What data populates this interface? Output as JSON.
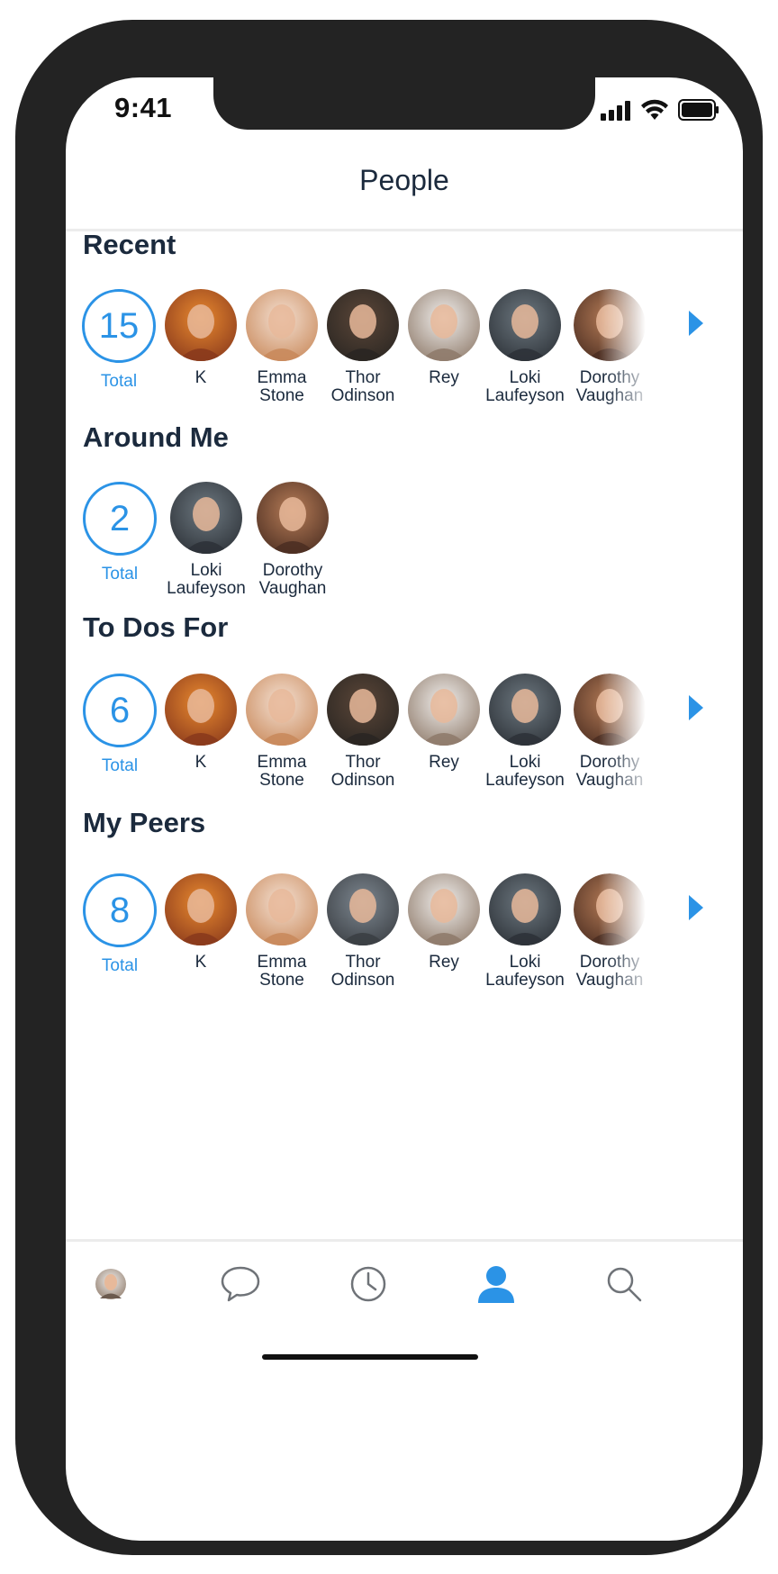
{
  "status_bar": {
    "time": "9:41"
  },
  "header": {
    "title": "People"
  },
  "sections": [
    {
      "title": "Recent",
      "total": "15",
      "total_label": "Total",
      "people": [
        {
          "name": "K",
          "avatar": "orange"
        },
        {
          "name": "Emma Stone",
          "avatar": "emma"
        },
        {
          "name": "Thor Odinson",
          "avatar": "dark"
        },
        {
          "name": "Rey",
          "avatar": "light"
        },
        {
          "name": "Loki Laufeyson",
          "avatar": "loki"
        },
        {
          "name": "Dorothy Vaughan",
          "avatar": "brown"
        }
      ],
      "has_more": true
    },
    {
      "title": "Around Me",
      "total": "2",
      "total_label": "Total",
      "people": [
        {
          "name": "Loki Laufeyson",
          "avatar": "loki"
        },
        {
          "name": "Dorothy Vaughan",
          "avatar": "brown"
        }
      ],
      "has_more": false
    },
    {
      "title": "To Dos For",
      "total": "6",
      "total_label": "Total",
      "people": [
        {
          "name": "K",
          "avatar": "orange"
        },
        {
          "name": "Emma Stone",
          "avatar": "emma"
        },
        {
          "name": "Thor Odinson",
          "avatar": "dark"
        },
        {
          "name": "Rey",
          "avatar": "light"
        },
        {
          "name": "Loki Laufeyson",
          "avatar": "loki"
        },
        {
          "name": "Dorothy Vaughan",
          "avatar": "brown"
        }
      ],
      "has_more": true
    },
    {
      "title": "My Peers",
      "total": "8",
      "total_label": "Total",
      "people": [
        {
          "name": "K",
          "avatar": "orange"
        },
        {
          "name": "Emma Stone",
          "avatar": "emma"
        },
        {
          "name": "Thor Odinson",
          "avatar": "helmet"
        },
        {
          "name": "Rey",
          "avatar": "light"
        },
        {
          "name": "Loki Laufeyson",
          "avatar": "loki"
        },
        {
          "name": "Dorothy Vaughan",
          "avatar": "brown"
        }
      ],
      "has_more": true
    }
  ],
  "tab_bar": {
    "items": [
      {
        "name": "profile-avatar",
        "icon": "avatar-icon",
        "active": false
      },
      {
        "name": "messages",
        "icon": "chat-bubble-icon",
        "active": false
      },
      {
        "name": "history",
        "icon": "clock-icon",
        "active": false
      },
      {
        "name": "people",
        "icon": "person-icon",
        "active": true
      },
      {
        "name": "search",
        "icon": "search-icon",
        "active": false
      }
    ]
  },
  "colors": {
    "accent": "#2b93e6",
    "text": "#1b2a3d",
    "inactive_icon": "#6f7378",
    "avatar_palette": {
      "orange": [
        "#e8892f",
        "#8a3a1c"
      ],
      "emma": [
        "#f4e0d2",
        "#c98a5c"
      ],
      "dark": [
        "#5b4638",
        "#2a2622"
      ],
      "helmet": [
        "#7d8790",
        "#3b3f44"
      ],
      "light": [
        "#f1efed",
        "#8f7b6b"
      ],
      "loki": [
        "#6d7880",
        "#2d3238"
      ],
      "brown": [
        "#b67c57",
        "#4d2f22"
      ]
    }
  }
}
